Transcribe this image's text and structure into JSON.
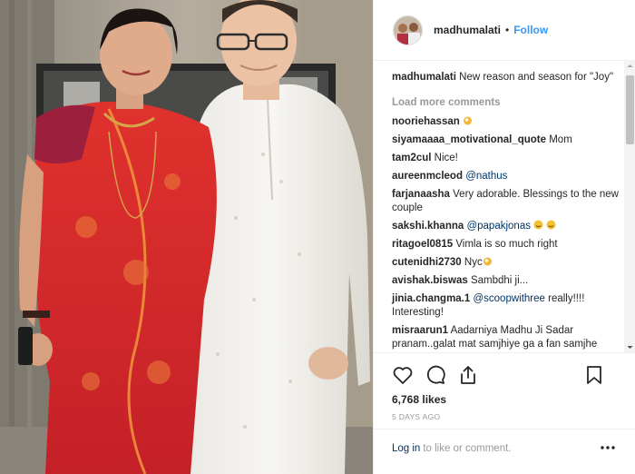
{
  "post": {
    "username": "madhumalati",
    "separator": "•",
    "follow_label": "Follow",
    "caption_username": "madhumalati",
    "caption_text": "New reason and season for \"Joy\"",
    "load_more_label": "Load more comments",
    "likes": "6,768 likes",
    "date": "5 DAYS AGO",
    "login_link": "Log in",
    "login_text": "to like or comment."
  },
  "comments": [
    {
      "user": "nooriehassan",
      "text": "",
      "emoji_after": "ok-hand"
    },
    {
      "user": "siyamaaaa_motivational_quote",
      "text": "Mom"
    },
    {
      "user": "tam2cul",
      "text": "Nice!"
    },
    {
      "user": "aureenmcleod",
      "text": "",
      "mention": "@nathus"
    },
    {
      "user": "farjanaasha",
      "text": "Very adorable. Blessings to the new couple"
    },
    {
      "user": "sakshi.khanna",
      "text": "",
      "mention": "@papakjonas",
      "emoji_after": "smile-smile"
    },
    {
      "user": "ritagoel0815",
      "text": "Vimla is so much right"
    },
    {
      "user": "cutenidhi2730",
      "text": "Nyc",
      "emoji_after": "ok-hand"
    },
    {
      "user": "avishak.biswas",
      "text": "Sambdhi ji..."
    },
    {
      "user": "jinia.changma.1",
      "text": "really!!!! Interesting!",
      "mention": "@scoopwithree"
    },
    {
      "user": "misraarun1",
      "text": "Aadarniya Madhu Ji Sadar pranam..galat mat samjhiye ga a fan samjhe"
    }
  ],
  "icons": {
    "like": "heart-icon",
    "comment": "comment-icon",
    "share": "share-icon",
    "save": "bookmark-icon",
    "more": "more-options-icon"
  },
  "colors": {
    "link_blue": "#3897f0",
    "mention_navy": "#003569",
    "muted_gray": "#999999",
    "text": "#262626",
    "border": "#efefef"
  }
}
